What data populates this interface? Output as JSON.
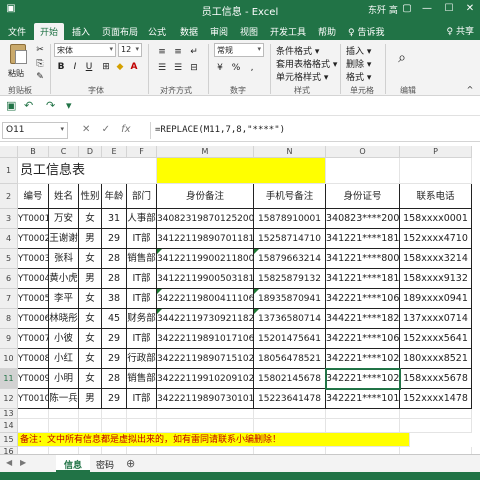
{
  "window": {
    "title": "员工信息 - Excel",
    "user": "东歼 高",
    "controls": [
      "▢",
      "—",
      "☐",
      "✕"
    ]
  },
  "ribbon_tabs": [
    "文件",
    "开始",
    "插入",
    "页面布局",
    "公式",
    "数据",
    "审阅",
    "视图",
    "开发工具",
    "帮助",
    "♀ 告诉我"
  ],
  "active_tab": "开始",
  "share_label": "♀ 共享",
  "ribbon": {
    "paste": "粘贴",
    "font_name": "宋体",
    "font_size": "12",
    "number_format": "常规",
    "styles": [
      "条件格式 ▾",
      "套用表格格式 ▾",
      "单元格样式 ▾"
    ],
    "cells": [
      "插入 ▾",
      "删除 ▾",
      "格式 ▾"
    ],
    "groups": [
      "剪贴板",
      "字体",
      "对齐方式",
      "数字",
      "样式",
      "单元格",
      "编辑"
    ]
  },
  "namebox": "O11",
  "formula": "=REPLACE(M11,7,8,\"****\")",
  "columns": [
    "A",
    "B",
    "C",
    "D",
    "E",
    "F",
    "M",
    "N",
    "O",
    "P"
  ],
  "sheet_title": "员工信息表",
  "headers": [
    "编号",
    "姓名",
    "性别",
    "年龄",
    "部门",
    "身份备注",
    "手机号备注",
    "身份证号",
    "联系电话"
  ],
  "rows": [
    [
      "YT0001",
      "万安",
      "女",
      "31",
      "人事部",
      "340823198701252000",
      "15878910001",
      "340823****2000",
      "158xxxx0001"
    ],
    [
      "YT0002",
      "王谢谢",
      "男",
      "29",
      "IT部",
      "341221198907011810",
      "15258714710",
      "341221****1810",
      "152xxxx4710"
    ],
    [
      "YT0003",
      "张科",
      "女",
      "28",
      "销售部",
      "341221199002118000",
      "15879663214",
      "341221****8000",
      "158xxxx3214"
    ],
    [
      "YT0004",
      "黄小虎",
      "男",
      "28",
      "IT部",
      "341221199005031810",
      "15825879132",
      "341221****1810",
      "158xxxx9132"
    ],
    [
      "YT0005",
      "李平",
      "女",
      "38",
      "IT部",
      "342221198004111063",
      "18935870941",
      "342221****1063",
      "189xxxx0941"
    ],
    [
      "YT0006",
      "林晓彤",
      "女",
      "45",
      "财务部",
      "344221197309211821",
      "13736580714",
      "344221****1821",
      "137xxxx0714"
    ],
    [
      "YT0007",
      "小彼",
      "女",
      "29",
      "IT部",
      "342221198910171063",
      "15201475641",
      "342221****1063",
      "152xxxx5641"
    ],
    [
      "YT0008",
      "小红",
      "女",
      "29",
      "行政部",
      "342221198907151023",
      "18056478521",
      "342221****1023",
      "180xxxx8521"
    ],
    [
      "YT0009",
      "小明",
      "女",
      "28",
      "销售部",
      "342221199102091025",
      "15802145678",
      "342221****1025",
      "158xxxx5678"
    ],
    [
      "YT0010",
      "陈一兵",
      "男",
      "29",
      "IT部",
      "342221198907301015",
      "15223641478",
      "342221****1015",
      "152xxxx1478"
    ]
  ],
  "note": "备注：文中所有信息都是虚拟出来的，如有雷同请联系小编删除！",
  "sheets": [
    "信息",
    "密码"
  ],
  "active_sheet": "信息",
  "colors": {
    "excel_green": "#217346",
    "yellow": "#ffff00",
    "note_text": "#c00000"
  }
}
